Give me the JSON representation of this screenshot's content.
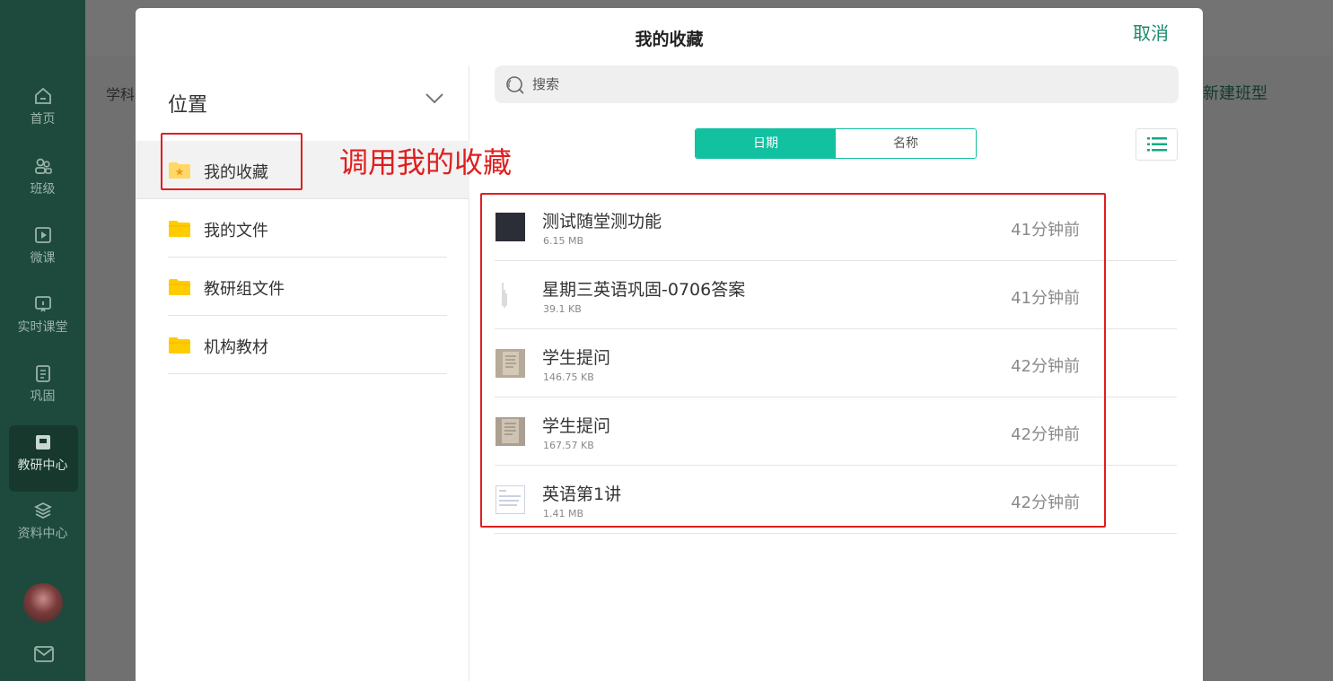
{
  "sidebar": {
    "items": [
      {
        "label": "首页",
        "icon": "home-icon"
      },
      {
        "label": "班级",
        "icon": "users-icon"
      },
      {
        "label": "微课",
        "icon": "play-icon"
      },
      {
        "label": "实时课堂",
        "icon": "live-class-icon"
      },
      {
        "label": "巩固",
        "icon": "list-doc-icon"
      },
      {
        "label": "教研中心",
        "icon": "book-icon",
        "active": true
      },
      {
        "label": "资料中心",
        "icon": "layers-icon"
      }
    ]
  },
  "background": {
    "subject_label": "学科",
    "new_class_label": "新建班型"
  },
  "modal": {
    "title": "我的收藏",
    "cancel_label": "取消",
    "location_header": "位置",
    "folders": [
      {
        "label": "我的收藏",
        "icon": "star-folder-icon",
        "active": true
      },
      {
        "label": "我的文件",
        "icon": "folder-icon"
      },
      {
        "label": "教研组文件",
        "icon": "folder-icon"
      },
      {
        "label": "机构教材",
        "icon": "folder-icon"
      }
    ],
    "search": {
      "placeholder": "搜索",
      "value": ""
    },
    "sort": {
      "date_label": "日期",
      "name_label": "名称",
      "active": "date"
    },
    "files": [
      {
        "name": "测试随堂测功能",
        "size": "6.15 MB",
        "time": "41分钟前",
        "thumb": "dark"
      },
      {
        "name": "星期三英语巩固-0706答案",
        "size": "39.1 KB",
        "time": "41分钟前",
        "thumb": "sketch"
      },
      {
        "name": "学生提问",
        "size": "146.75 KB",
        "time": "42分钟前",
        "thumb": "photo"
      },
      {
        "name": "学生提问",
        "size": "167.57 KB",
        "time": "42分钟前",
        "thumb": "photo"
      },
      {
        "name": "英语第1讲",
        "size": "1.41 MB",
        "time": "42分钟前",
        "thumb": "doc"
      }
    ]
  },
  "annotation": {
    "text": "调用我的收藏",
    "color": "#e01e1e"
  },
  "colors": {
    "accent": "#12c1a0",
    "sidebar": "#1d4a3c",
    "cancel": "#1a8a6a",
    "folder": "#ffcc00"
  }
}
